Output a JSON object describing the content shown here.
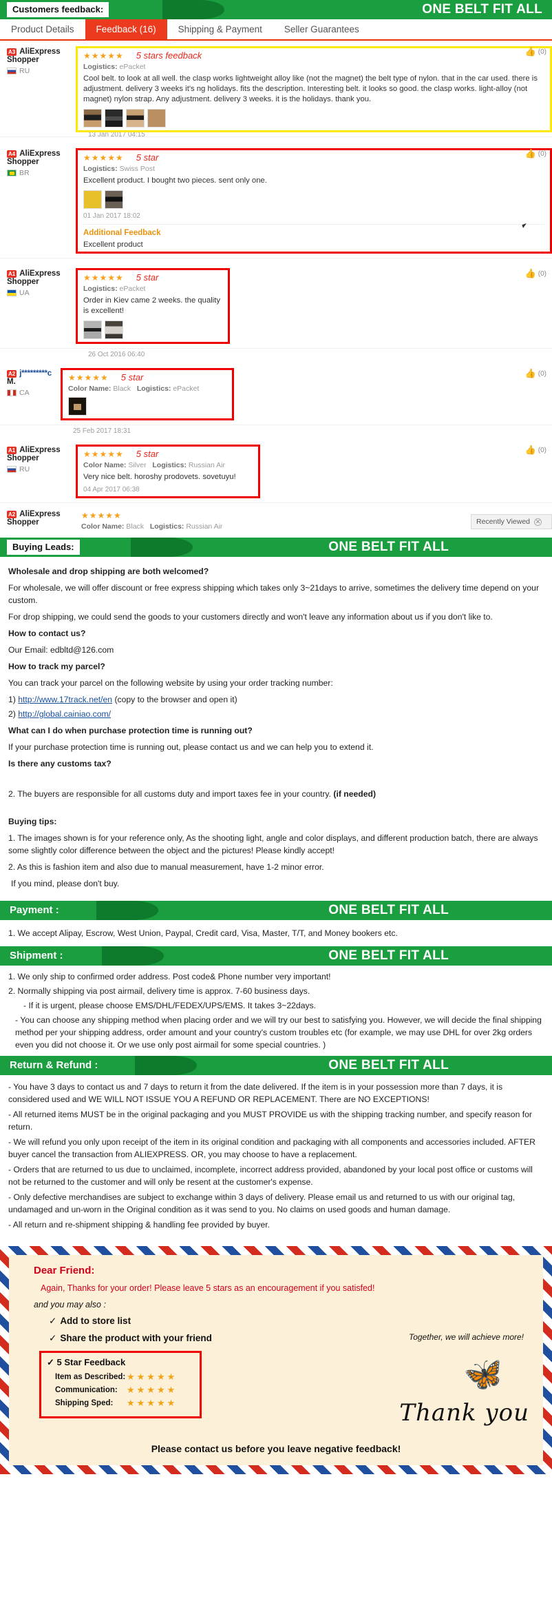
{
  "banners": {
    "feedback": {
      "left": "Customers feedback:",
      "right": "ONE BELT FIT ALL"
    },
    "buying_leads": {
      "left": "Buying Leads:",
      "right": "ONE BELT FIT ALL"
    },
    "payment": {
      "left": "Payment :",
      "right": "ONE BELT FIT ALL"
    },
    "shipment": {
      "left": "Shipment :",
      "right": "ONE BELT FIT ALL"
    },
    "return": {
      "left": "Return & Refund :",
      "right": "ONE BELT FIT ALL"
    }
  },
  "tabs": [
    {
      "label": "Product Details",
      "active": false
    },
    {
      "label": "Feedback (16)",
      "active": true
    },
    {
      "label": "Shipping & Payment",
      "active": false
    },
    {
      "label": "Seller Guarantees",
      "active": false
    }
  ],
  "reviews": [
    {
      "badge": "A3",
      "user": "AliExpress",
      "user2": "Shopper",
      "country": "RU",
      "flag": "ru",
      "stars": "★★★★★",
      "note": "5 stars feedback",
      "logistics_label": "Logistics:",
      "logistics": "ePacket",
      "color_label": "",
      "color": "",
      "text": "Cool belt. to look at all well. the clasp works lightweight alloy like (not the magnet) the belt type of nylon. that in the car used. there is adjustment. delivery 3 weeks it's ng holidays. fits the description. Interesting belt. it looks so good. the clasp works. light-alloy (not magnet) nylon strap. Any adjustment. delivery 3 weeks. it is the holidays. thank you.",
      "date": "13 Jan 2017 04:15",
      "thumbs": 4,
      "helpful": "(0)",
      "highlight": "yellow"
    },
    {
      "badge": "A4",
      "user": "AliExpress",
      "user2": "Shopper",
      "country": "BR",
      "flag": "br",
      "stars": "★★★★★",
      "note": "5 star",
      "logistics_label": "Logistics:",
      "logistics": "Swiss Post",
      "color_label": "",
      "color": "",
      "text": "Excellent product. I bought two pieces. sent only one.",
      "date": "01 Jan 2017 18:02",
      "thumbs": 2,
      "helpful": "(0)",
      "highlight": "red",
      "additional_title": "Additional Feedback",
      "additional_text": "Excellent product"
    },
    {
      "badge": "A1",
      "user": "AliExpress",
      "user2": "Shopper",
      "country": "UA",
      "flag": "ua",
      "stars": "★★★★★",
      "note": "5 star",
      "logistics_label": "Logistics:",
      "logistics": "ePacket",
      "color_label": "",
      "color": "",
      "text": "Order in Kiev came 2 weeks. the quality is excellent!",
      "date": "26 Oct 2016 06:40",
      "thumbs": 2,
      "helpful": "(0)",
      "highlight": "red"
    },
    {
      "badge": "A2",
      "user": "j*********c",
      "user2": "M.",
      "country": "CA",
      "flag": "ca",
      "stars": "★★★★★",
      "note": "5 star",
      "logistics_label": "Logistics:",
      "logistics": "ePacket",
      "color_label": "Color Name:",
      "color": "Black",
      "text": "",
      "date": "25 Feb 2017 18:31",
      "thumbs": 1,
      "helpful": "(0)",
      "highlight": "red"
    },
    {
      "badge": "A1",
      "user": "AliExpress",
      "user2": "Shopper",
      "country": "RU",
      "flag": "ru",
      "stars": "★★★★★",
      "note": "5 star",
      "logistics_label": "Logistics:",
      "logistics": "Russian Air",
      "color_label": "Color Name:",
      "color": "Silver",
      "text": "Very nice belt. horoshy prodovets. sovetuyu!",
      "date": "04 Apr 2017 06:38",
      "thumbs": 0,
      "helpful": "(0)",
      "highlight": "red"
    },
    {
      "badge": "A2",
      "user": "AliExpress",
      "user2": "Shopper",
      "country": "",
      "flag": "",
      "stars": "★★★★★",
      "note": "",
      "logistics_label": "Logistics:",
      "logistics": "Russian Air",
      "color_label": "Color Name:",
      "color": "Black",
      "text": "",
      "date": "",
      "thumbs": 0,
      "helpful": "",
      "highlight": "none"
    }
  ],
  "recently_viewed": {
    "label": "Recently Viewed",
    "close": "✕"
  },
  "buying_leads": {
    "q1": "Wholesale and drop shipping are both welcomed?",
    "a1": "For wholesale, we will offer discount or free express shipping which takes only 3~21days to arrive, sometimes the delivery time depend on your custom.",
    "a1b": "For drop shipping, we could send the goods to your customers directly and won't leave any information about us if you don't like to.",
    "q2": "How to contact us?",
    "a2": "Our Email: edbltd@126.com",
    "q3": "How to track my parcel?",
    "a3": "You can track your parcel on the following website by using your order tracking number:",
    "link1_prefix": "1) ",
    "link1": "http://www.17track.net/en",
    "link1_suffix": "(copy to the browser and open it)",
    "link2_prefix": "2) ",
    "link2": "http://global.cainiao.com/",
    "q4": "What can I do when purchase protection time is running out?",
    "a4": "If your purchase protection time is running out, please contact us and we can help you to extend it.",
    "q5": "Is there any customs tax?",
    "a5": "2. The buyers are responsible for all customs duty and import taxes fee in your country.",
    "a5_bold": "(if needed)",
    "tips_title": "Buying tips:",
    "tip1": "1. The images shown is for your reference only, As the shooting light, angle and color displays, and different production batch, there are always some slightly color difference between the object and the pictures! Please kindly accept!",
    "tip2": "2. As this is fashion item and also due to manual measurement, have 1-2 minor error.",
    "tip3": "If you mind, please don't buy."
  },
  "payment": {
    "line1": "1. We accept Alipay, Escrow, West Union, Paypal, Credit card, Visa, Master, T/T, and Money bookers etc."
  },
  "shipment": {
    "line1": "1. We only ship to confirmed order address. Post code& Phone number very important!",
    "line2": "2. Normally shipping via post airmail, delivery time is approx. 7-60 business days.",
    "line3": "- If it is urgent, please choose EMS/DHL/FEDEX/UPS/EMS. It takes 3~22days.",
    "line4": "- You can choose any shipping method when placing order and we will try our best to satisfying you. However, we will decide the final shipping method per your shipping address, order amount and your country's custom troubles etc (for example, we may use DHL for over 2kg orders even you did not choose it. Or we use only post airmail for some special countries. )"
  },
  "refund": {
    "line1": "- You have 3 days to contact us and 7 days to return it from the date delivered. If the item is in your possession more than 7 days, it is considered used and WE WILL NOT ISSUE YOU A REFUND OR REPLACEMENT. There are NO EXCEPTIONS!",
    "line2": "- All returned items MUST be in the original packaging and you MUST PROVIDE us with the shipping tracking number, and specify reason for return.",
    "line3": "- We will refund you only upon receipt of the item in its original condition and packaging with all components and accessories included. AFTER buyer cancel the transaction from ALIEXPRESS. OR, you may choose to have a replacement.",
    "line4": "- Orders that are returned to us due to unclaimed, incomplete, incorrect address provided, abandoned by your local post office or customs will not be returned to the customer and will only be resent at the customer's expense.",
    "line5": "- Only defective merchandises are subject to exchange within 3 days of delivery. Please email us and returned to us with our original tag, undamaged and un-worn in the Original condition as it was send to you. No claims on used goods and human damage.",
    "line6": "- All return and re-shipment shipping & handling fee provided by buyer."
  },
  "thankyou": {
    "greeting": "Dear Friend:",
    "line1": "Again, Thanks for your order! Please leave 5 stars as an encouragement if you satisfed!",
    "line2": "and you may also :",
    "check1": "Add to store list",
    "check2": "Share the product with your friend",
    "check3": "5 Star Feedback",
    "check_mark": "✓",
    "together": "Together, we will achieve more!",
    "ratings": [
      {
        "label": "Item as Described:",
        "stars": "★★★★★"
      },
      {
        "label": "Communication:",
        "stars": "★★★★★"
      },
      {
        "label": "Shipping Sped:",
        "stars": "★★★★★"
      }
    ],
    "script": "Thank you",
    "footer": "Please contact us before you leave negative feedback!",
    "butterfly_icon": "🦋"
  }
}
